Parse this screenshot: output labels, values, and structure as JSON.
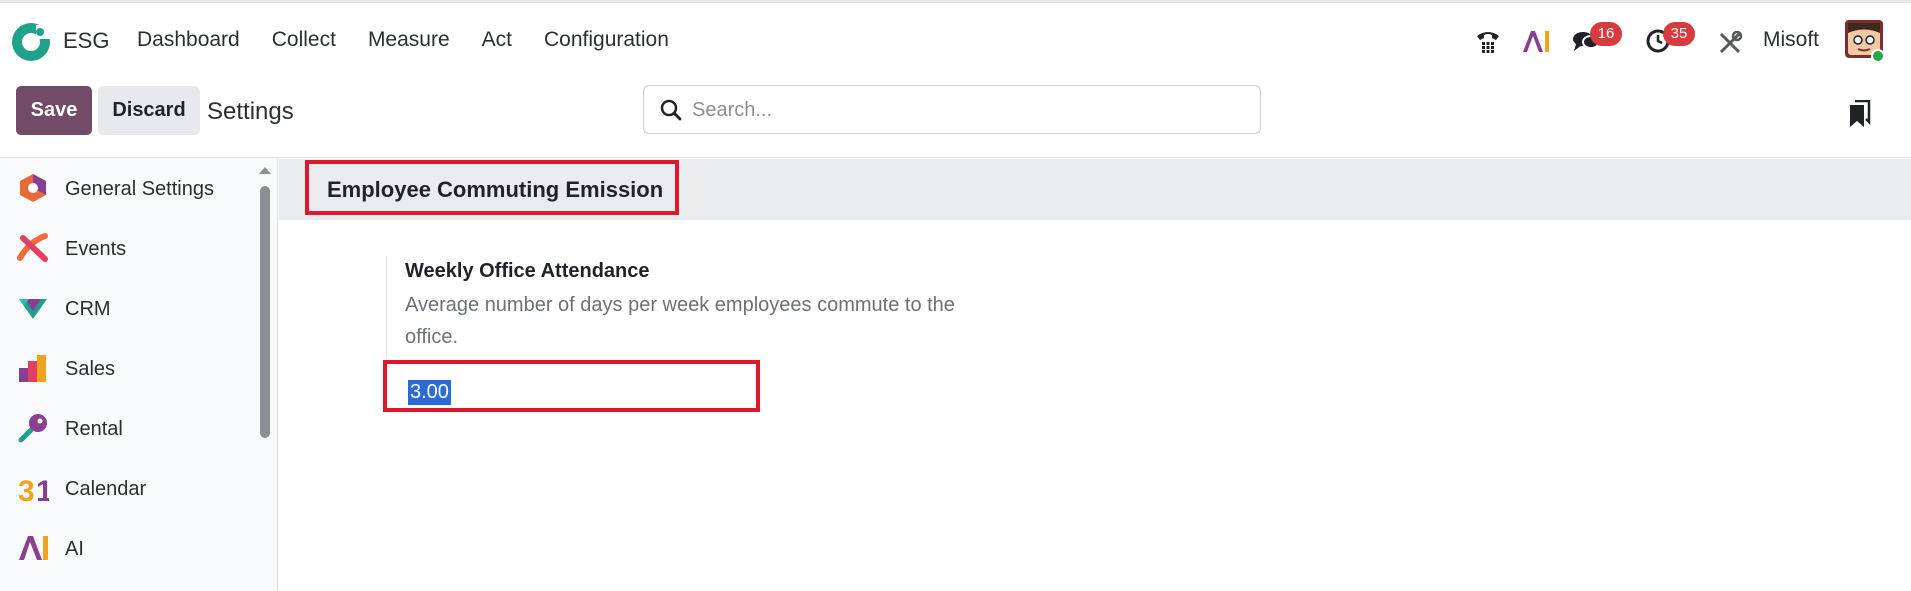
{
  "app": {
    "brand": "ESG",
    "menu": [
      "Dashboard",
      "Collect",
      "Measure",
      "Act",
      "Configuration"
    ]
  },
  "systray": {
    "messages_count": "16",
    "activities_count": "35",
    "company_name": "Misoft"
  },
  "control_panel": {
    "save_label": "Save",
    "discard_label": "Discard",
    "title": "Settings",
    "search_placeholder": "Search..."
  },
  "sidebar": {
    "items": [
      {
        "label": "General Settings",
        "icon": "settings-hexagon-icon"
      },
      {
        "label": "Events",
        "icon": "events-icon"
      },
      {
        "label": "CRM",
        "icon": "crm-icon"
      },
      {
        "label": "Sales",
        "icon": "sales-icon"
      },
      {
        "label": "Rental",
        "icon": "rental-icon"
      },
      {
        "label": "Calendar",
        "icon": "calendar-icon"
      },
      {
        "label": "AI",
        "icon": "ai-icon"
      }
    ]
  },
  "section": {
    "title": "Employee Commuting Emission",
    "setting": {
      "title": "Weekly Office Attendance",
      "description": "Average number of days per week employees commute to the office.",
      "value": "3.00"
    }
  },
  "colors": {
    "primary": "#714b67",
    "highlight_border": "#e0162b",
    "badge": "#d63b3f",
    "selection": "#2b6bd6"
  }
}
